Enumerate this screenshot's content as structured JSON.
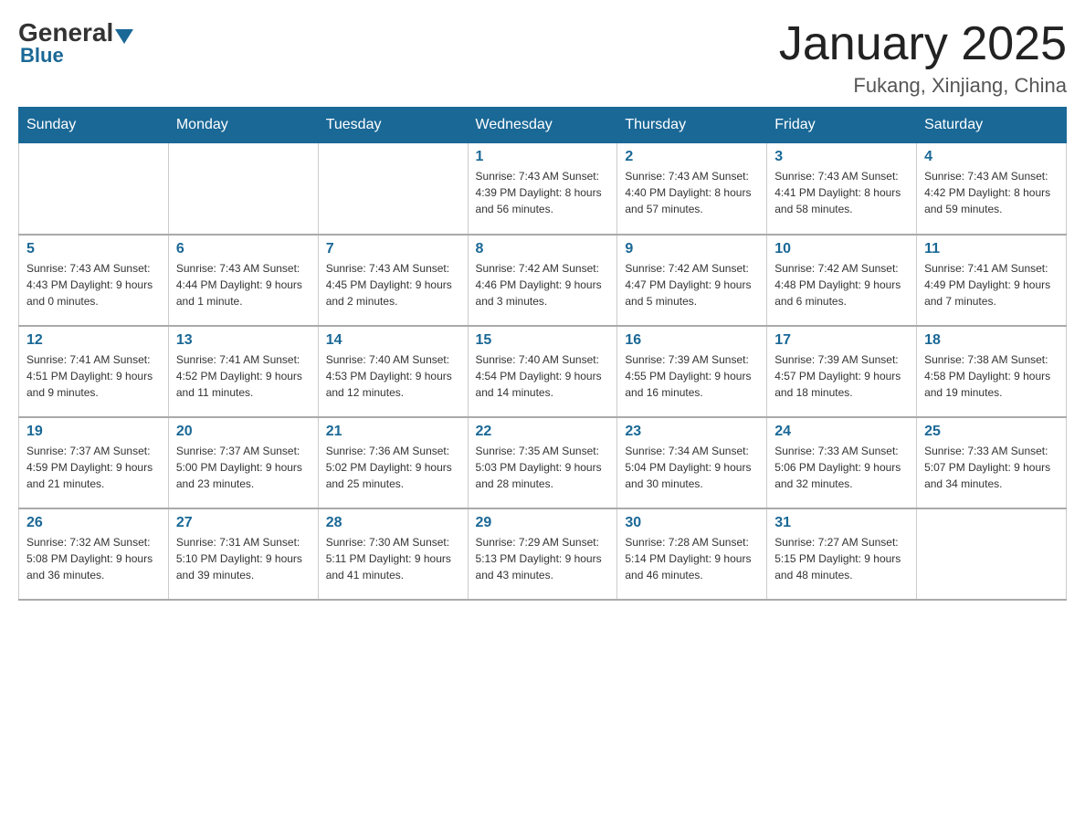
{
  "logo": {
    "general": "General",
    "blue": "Blue"
  },
  "title": "January 2025",
  "subtitle": "Fukang, Xinjiang, China",
  "days_of_week": [
    "Sunday",
    "Monday",
    "Tuesday",
    "Wednesday",
    "Thursday",
    "Friday",
    "Saturday"
  ],
  "weeks": [
    [
      {
        "day": "",
        "info": ""
      },
      {
        "day": "",
        "info": ""
      },
      {
        "day": "",
        "info": ""
      },
      {
        "day": "1",
        "info": "Sunrise: 7:43 AM\nSunset: 4:39 PM\nDaylight: 8 hours\nand 56 minutes."
      },
      {
        "day": "2",
        "info": "Sunrise: 7:43 AM\nSunset: 4:40 PM\nDaylight: 8 hours\nand 57 minutes."
      },
      {
        "day": "3",
        "info": "Sunrise: 7:43 AM\nSunset: 4:41 PM\nDaylight: 8 hours\nand 58 minutes."
      },
      {
        "day": "4",
        "info": "Sunrise: 7:43 AM\nSunset: 4:42 PM\nDaylight: 8 hours\nand 59 minutes."
      }
    ],
    [
      {
        "day": "5",
        "info": "Sunrise: 7:43 AM\nSunset: 4:43 PM\nDaylight: 9 hours\nand 0 minutes."
      },
      {
        "day": "6",
        "info": "Sunrise: 7:43 AM\nSunset: 4:44 PM\nDaylight: 9 hours\nand 1 minute."
      },
      {
        "day": "7",
        "info": "Sunrise: 7:43 AM\nSunset: 4:45 PM\nDaylight: 9 hours\nand 2 minutes."
      },
      {
        "day": "8",
        "info": "Sunrise: 7:42 AM\nSunset: 4:46 PM\nDaylight: 9 hours\nand 3 minutes."
      },
      {
        "day": "9",
        "info": "Sunrise: 7:42 AM\nSunset: 4:47 PM\nDaylight: 9 hours\nand 5 minutes."
      },
      {
        "day": "10",
        "info": "Sunrise: 7:42 AM\nSunset: 4:48 PM\nDaylight: 9 hours\nand 6 minutes."
      },
      {
        "day": "11",
        "info": "Sunrise: 7:41 AM\nSunset: 4:49 PM\nDaylight: 9 hours\nand 7 minutes."
      }
    ],
    [
      {
        "day": "12",
        "info": "Sunrise: 7:41 AM\nSunset: 4:51 PM\nDaylight: 9 hours\nand 9 minutes."
      },
      {
        "day": "13",
        "info": "Sunrise: 7:41 AM\nSunset: 4:52 PM\nDaylight: 9 hours\nand 11 minutes."
      },
      {
        "day": "14",
        "info": "Sunrise: 7:40 AM\nSunset: 4:53 PM\nDaylight: 9 hours\nand 12 minutes."
      },
      {
        "day": "15",
        "info": "Sunrise: 7:40 AM\nSunset: 4:54 PM\nDaylight: 9 hours\nand 14 minutes."
      },
      {
        "day": "16",
        "info": "Sunrise: 7:39 AM\nSunset: 4:55 PM\nDaylight: 9 hours\nand 16 minutes."
      },
      {
        "day": "17",
        "info": "Sunrise: 7:39 AM\nSunset: 4:57 PM\nDaylight: 9 hours\nand 18 minutes."
      },
      {
        "day": "18",
        "info": "Sunrise: 7:38 AM\nSunset: 4:58 PM\nDaylight: 9 hours\nand 19 minutes."
      }
    ],
    [
      {
        "day": "19",
        "info": "Sunrise: 7:37 AM\nSunset: 4:59 PM\nDaylight: 9 hours\nand 21 minutes."
      },
      {
        "day": "20",
        "info": "Sunrise: 7:37 AM\nSunset: 5:00 PM\nDaylight: 9 hours\nand 23 minutes."
      },
      {
        "day": "21",
        "info": "Sunrise: 7:36 AM\nSunset: 5:02 PM\nDaylight: 9 hours\nand 25 minutes."
      },
      {
        "day": "22",
        "info": "Sunrise: 7:35 AM\nSunset: 5:03 PM\nDaylight: 9 hours\nand 28 minutes."
      },
      {
        "day": "23",
        "info": "Sunrise: 7:34 AM\nSunset: 5:04 PM\nDaylight: 9 hours\nand 30 minutes."
      },
      {
        "day": "24",
        "info": "Sunrise: 7:33 AM\nSunset: 5:06 PM\nDaylight: 9 hours\nand 32 minutes."
      },
      {
        "day": "25",
        "info": "Sunrise: 7:33 AM\nSunset: 5:07 PM\nDaylight: 9 hours\nand 34 minutes."
      }
    ],
    [
      {
        "day": "26",
        "info": "Sunrise: 7:32 AM\nSunset: 5:08 PM\nDaylight: 9 hours\nand 36 minutes."
      },
      {
        "day": "27",
        "info": "Sunrise: 7:31 AM\nSunset: 5:10 PM\nDaylight: 9 hours\nand 39 minutes."
      },
      {
        "day": "28",
        "info": "Sunrise: 7:30 AM\nSunset: 5:11 PM\nDaylight: 9 hours\nand 41 minutes."
      },
      {
        "day": "29",
        "info": "Sunrise: 7:29 AM\nSunset: 5:13 PM\nDaylight: 9 hours\nand 43 minutes."
      },
      {
        "day": "30",
        "info": "Sunrise: 7:28 AM\nSunset: 5:14 PM\nDaylight: 9 hours\nand 46 minutes."
      },
      {
        "day": "31",
        "info": "Sunrise: 7:27 AM\nSunset: 5:15 PM\nDaylight: 9 hours\nand 48 minutes."
      },
      {
        "day": "",
        "info": ""
      }
    ]
  ]
}
